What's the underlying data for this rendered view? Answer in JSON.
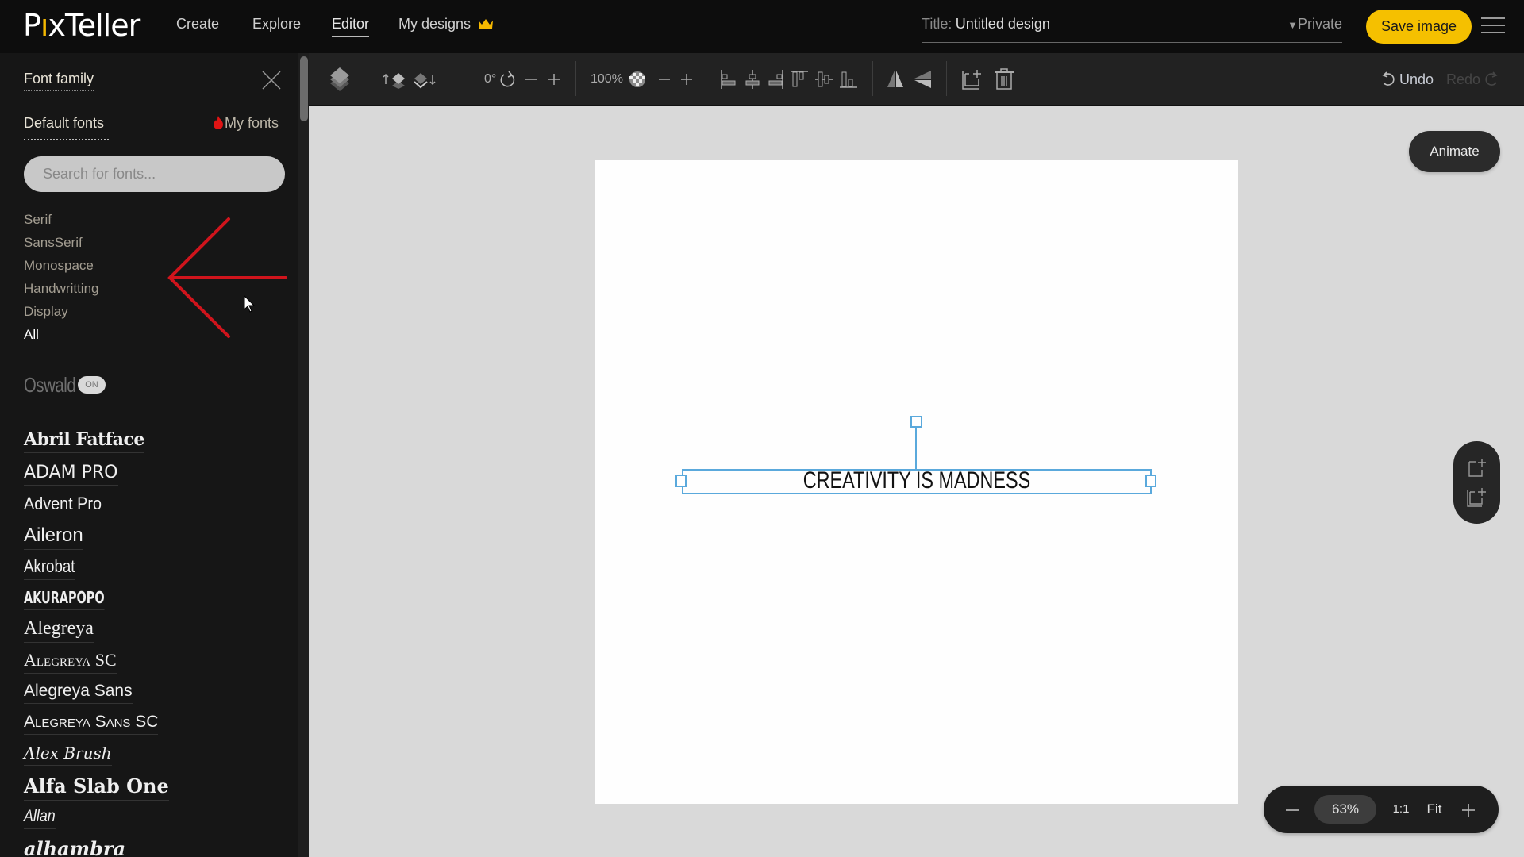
{
  "app": {
    "brand": "PixTeller",
    "nav": [
      {
        "label": "Create",
        "active": false
      },
      {
        "label": "Explore",
        "active": false
      },
      {
        "label": "Editor",
        "active": true
      },
      {
        "label": "My designs",
        "active": false,
        "icon": "crown-icon"
      }
    ],
    "title_label": "Title:",
    "title_value": "Untitled design",
    "privacy": "Private",
    "save_label": "Save image",
    "menu_icon": "hamburger-icon",
    "colors": {
      "accent": "#f5c000",
      "selection": "#5aa9dc",
      "topbar": "#0d0d0d",
      "sidebar": "#161616",
      "toolbar": "#222222",
      "workspace": "#d9d9d9"
    }
  },
  "toolbar": {
    "rotation": "0°",
    "opacity": "100%",
    "undo_label": "Undo",
    "redo_label": "Redo",
    "icons": [
      "layers-icon",
      "bring-forward-icon",
      "send-backward-icon",
      "rotate-icon",
      "rotate-minus-icon",
      "rotate-plus-icon",
      "transparency-icon",
      "opacity-minus-icon",
      "opacity-plus-icon",
      "align-left-icon",
      "align-center-icon",
      "align-right-icon",
      "align-top-icon",
      "align-middle-icon",
      "align-bottom-icon",
      "flip-horizontal-icon",
      "flip-vertical-icon",
      "duplicate-icon",
      "delete-icon",
      "undo-icon",
      "redo-icon"
    ]
  },
  "sidebar": {
    "title": "Font family",
    "tabs": [
      {
        "label": "Default fonts",
        "active": true
      },
      {
        "label": "My fonts",
        "active": false
      }
    ],
    "search_placeholder": "Search for fonts...",
    "categories": [
      {
        "label": "Serif",
        "active": false
      },
      {
        "label": "SansSerif",
        "active": false
      },
      {
        "label": "Monospace",
        "active": false
      },
      {
        "label": "Handwritting",
        "active": false
      },
      {
        "label": "Display",
        "active": false
      },
      {
        "label": "All",
        "active": true
      }
    ],
    "current_font": "Oswald",
    "current_badge": "ON",
    "fonts": [
      "Abril Fatface",
      "ADAM PRO",
      "Advent Pro",
      "Aileron",
      "Akrobat",
      "AKURAPOPO",
      "Alegreya",
      "Alegreya SC",
      "Alegreya Sans",
      "Alegreya Sans SC",
      "Alex Brush",
      "Alfa Slab One",
      "Allan",
      "alhambra"
    ]
  },
  "canvas": {
    "text": "CREATIVITY IS MADNESS",
    "animate_label": "Animate",
    "side_icons": [
      "add-page-icon",
      "duplicate-page-icon"
    ]
  },
  "zoom": {
    "value": "63%",
    "one_to_one": "1:1",
    "fit": "Fit"
  }
}
